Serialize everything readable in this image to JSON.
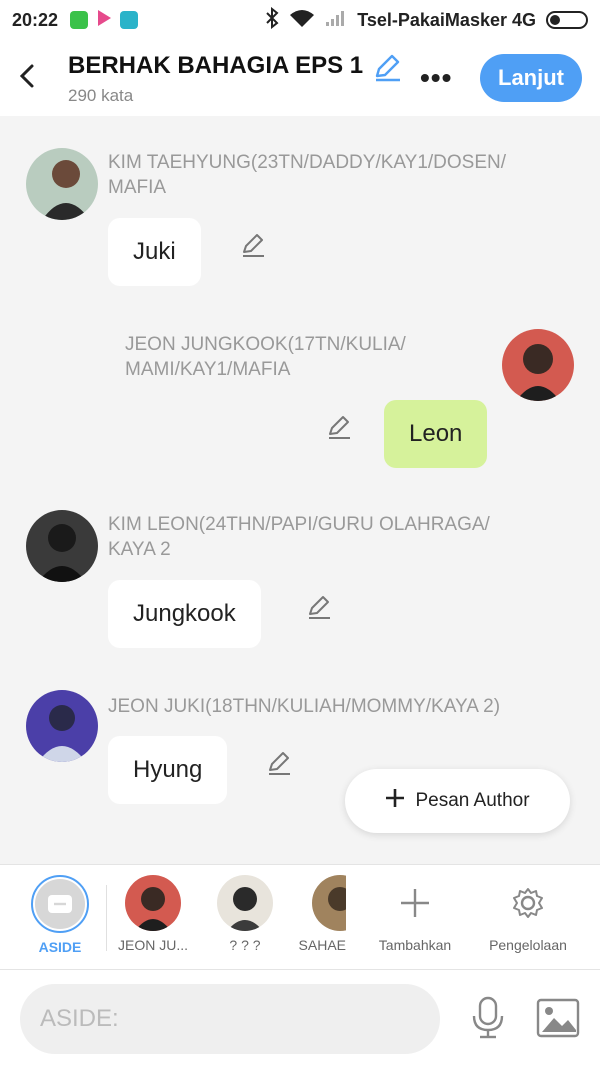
{
  "status": {
    "time": "20:22",
    "carrier": "Tsel-PakaiMasker 4G"
  },
  "header": {
    "title": "BERHAK BAHAGIA EPS 1",
    "word_count": "290 kata",
    "more_label": "•••",
    "next_label": "Lanjut"
  },
  "messages": [
    {
      "name": "KIM TAEHYUNG(23TN/DADDY/KAY1/DOSEN/\nMAFIA",
      "text": "Juki"
    },
    {
      "name": "JEON JUNGKOOK(17TN/KULIA/\nMAMI/KAY1/MAFIA",
      "text": "Leon"
    },
    {
      "name": "KIM LEON(24THN/PAPI/GURU OLAHRAGA/\nKAYA 2",
      "text": "Jungkook"
    },
    {
      "name": "JEON JUKI(18THN/KULIAH/MOMMY/KAYA 2)",
      "text": "Hyung"
    }
  ],
  "fab": {
    "label": "Pesan Author"
  },
  "character_bar": {
    "items": [
      {
        "label": "ASIDE"
      },
      {
        "label": "JEON JU..."
      },
      {
        "label": "? ? ?"
      },
      {
        "label": "SAHAE"
      },
      {
        "label": "Tambahkan"
      },
      {
        "label": "Pengelolaan"
      }
    ]
  },
  "composer": {
    "placeholder": "ASIDE:"
  },
  "colors": {
    "accent": "#4f9ff5",
    "right_bubble": "#d6f29b"
  }
}
